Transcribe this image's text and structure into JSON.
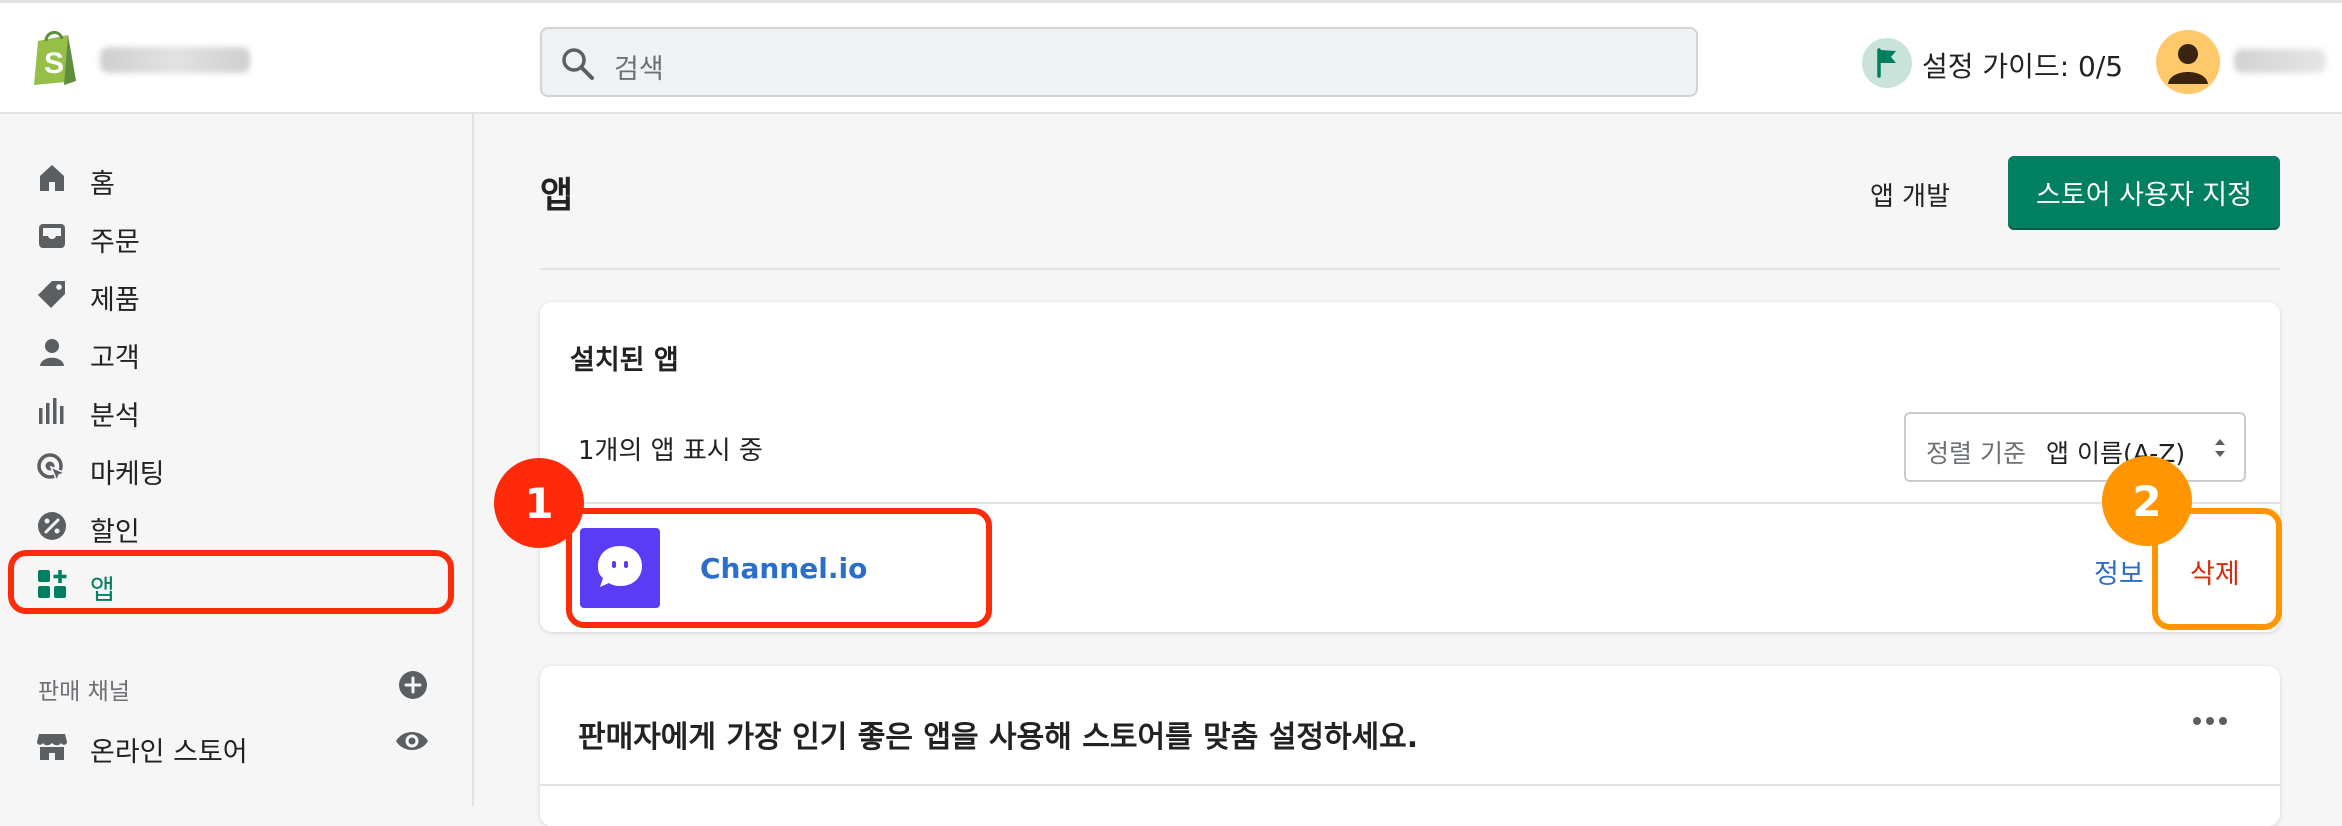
{
  "header": {
    "search_placeholder": "검색",
    "setup_guide": "설정 가이드: 0/5"
  },
  "sidebar": {
    "items": [
      {
        "label": "홈",
        "icon": "home-icon"
      },
      {
        "label": "주문",
        "icon": "inbox-icon"
      },
      {
        "label": "제품",
        "icon": "tag-icon"
      },
      {
        "label": "고객",
        "icon": "person-icon"
      },
      {
        "label": "분석",
        "icon": "bar-chart-icon"
      },
      {
        "label": "마케팅",
        "icon": "target-icon"
      },
      {
        "label": "할인",
        "icon": "discount-icon"
      },
      {
        "label": "앱",
        "icon": "apps-icon",
        "active": true
      }
    ],
    "sales_channels_title": "판매 채널",
    "channels": [
      {
        "label": "온라인 스토어",
        "icon": "store-icon"
      }
    ]
  },
  "main": {
    "title": "앱",
    "dev_link": "앱 개발",
    "primary_button": "스토어 사용자 지정",
    "installed_card": {
      "title": "설치된 앱",
      "count_text": "1개의 앱 표시 중",
      "sort_label": "정렬 기준",
      "sort_value": "앱 이름(A-Z)",
      "apps": [
        {
          "name": "Channel.io",
          "info_label": "정보",
          "delete_label": "삭제"
        }
      ]
    },
    "promo_card": {
      "text": "판매자에게 가장 인기 좋은 앱을 사용해 스토어를 맞춤 설정하세요."
    }
  },
  "annotations": [
    {
      "number": "1",
      "color": "#ff2a0a"
    },
    {
      "number": "2",
      "color": "#ff9500"
    }
  ],
  "colors": {
    "brand": "#008060",
    "link": "#2c6ecb",
    "destructive": "#d82c0d",
    "annotation_red": "#ff2a0a",
    "annotation_orange": "#ff9500"
  }
}
